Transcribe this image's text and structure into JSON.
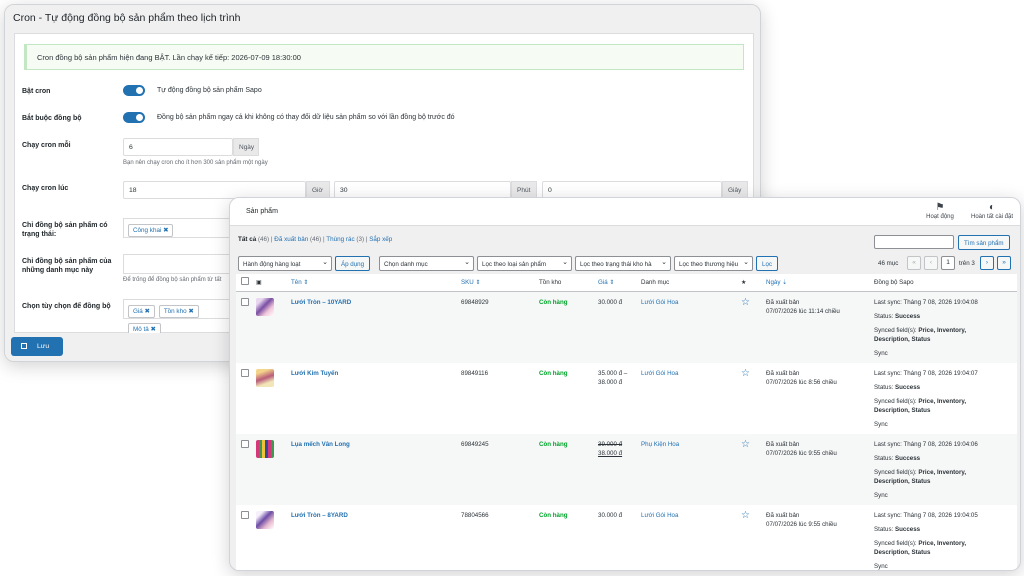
{
  "cron": {
    "title": "Cron - Tự động đồng bộ sản phẩm theo lịch trình",
    "notice": "Cron đồng bộ sản phẩm hiện đang BẬT. Lần chạy kế tiếp: 2026-07-09 18:30:00",
    "enable_label": "Bật cron",
    "enable_text": "Tự động đồng bộ sản phẩm Sapo",
    "force_label": "Bắt buộc đồng bộ",
    "force_text": "Đồng bộ sản phẩm ngay cả khi không có thay đổi dữ liệu sản phẩm so với lần đồng bộ trước đó",
    "every_label": "Chạy cron mỗi",
    "every_value": "6",
    "every_unit": "Ngày",
    "every_hint": "Bạn nên chạy cron cho ít hơn 300 sản phẩm một ngày",
    "at_label": "Chạy cron lúc",
    "hour_value": "18",
    "hour_unit": "Giờ",
    "minute_value": "30",
    "minute_unit": "Phút",
    "second_value": "0",
    "second_unit": "Giây",
    "status_label_1": "Chỉ đồng bộ sản phẩm có",
    "status_label_2": "trạng thái:",
    "status_tag": "Công khai ✖",
    "cat_label_1": "Chỉ đồng bộ sản phẩm của",
    "cat_label_2": "những danh mục này",
    "cat_hint": "Để trống để đồng bộ sản phẩm từ tất",
    "opt_label": "Chọn tùy chọn để đồng bộ",
    "opt_tags": [
      "Giá ✖",
      "Tồn kho ✖",
      "Mô tả ✖"
    ],
    "save": "Lưu"
  },
  "products": {
    "header_title": "Sản phẩm",
    "activity": "Hoạt động",
    "finish_setup": "Hoàn tất cài đặt",
    "sub_all": "Tất cả",
    "sub_all_count": "(46)",
    "sub_published": "Đã xuất bản",
    "sub_published_count": "(46)",
    "sub_trash": "Thùng rác",
    "sub_trash_count": "(3)",
    "sub_sort": "Sắp xếp",
    "search_button": "Tìm sản phẩm",
    "bulk": "Hành động hàng loạt",
    "apply": "Áp dụng",
    "filter_cat": "Chọn danh mục",
    "filter_type": "Lọc theo loại sản phẩm",
    "filter_stock": "Lọc theo trạng thái kho hà",
    "filter_brand": "Lọc theo thương hiệu",
    "filter_btn": "Lọc",
    "items_count": "46 mục",
    "page_current": "1",
    "page_of": "trên 3",
    "columns": {
      "name": "Tên ⇕",
      "sku": "SKU ⇕",
      "stock": "Tồn kho",
      "price": "Giá ⇕",
      "category": "Danh mục",
      "star": "★",
      "date": "Ngày ⇣",
      "sync": "Đồng bộ Sapo"
    },
    "rows": [
      {
        "name": "Lưới Tròn – 10YARD",
        "sku": "69848929",
        "stock": "Còn hàng",
        "price1": "30.000 đ",
        "price2": "",
        "category": "Lưới Gói Hoa",
        "date1": "Đã xuất bản",
        "date2": "07/07/2026 lúc 11:14 chiều",
        "sync_last": "Last sync: Tháng 7 08, 2026 19:04:08",
        "status": "Status:",
        "status_val": "Success",
        "fields": "Synced field(s):",
        "fields_val1": "Price, Inventory,",
        "fields_val2": "Description, Status",
        "sync_link": "Sync"
      },
      {
        "name": "Lưới Kim Tuyến",
        "sku": "89849116",
        "stock": "Còn hàng",
        "price1": "35.000 đ –",
        "price2": "38.000 đ",
        "category": "Lưới Gói Hoa",
        "date1": "Đã xuất bản",
        "date2": "07/07/2026 lúc 8:56 chiều",
        "sync_last": "Last sync: Tháng 7 08, 2026 19:04:07",
        "status": "Status:",
        "status_val": "Success",
        "fields": "Synced field(s):",
        "fields_val1": "Price, Inventory,",
        "fields_val2": "Description, Status",
        "sync_link": "Sync"
      },
      {
        "name": "Lụa mếch Vân Long",
        "sku": "69849245",
        "stock": "Còn hàng",
        "price1": "39.000 đ",
        "price2": "38.000 đ",
        "category": "Phụ Kiện Hoa",
        "date1": "Đã xuất bản",
        "date2": "07/07/2026 lúc 9:55 chiều",
        "sync_last": "Last sync: Tháng 7 08, 2026 19:04:06",
        "status": "Status:",
        "status_val": "Success",
        "fields": "Synced field(s):",
        "fields_val1": "Price, Inventory,",
        "fields_val2": "Description, Status",
        "sync_link": "Sync"
      },
      {
        "name": "Lưới Tròn – 8YARD",
        "sku": "78804566",
        "stock": "Còn hàng",
        "price1": "30.000 đ",
        "price2": "",
        "category": "Lưới Gói Hoa",
        "date1": "Đã xuất bản",
        "date2": "07/07/2026 lúc 9:55 chiều",
        "sync_last": "Last sync: Tháng 7 08, 2026 19:04:05",
        "status": "Status:",
        "status_val": "Success",
        "fields": "Synced field(s):",
        "fields_val1": "Price, Inventory,",
        "fields_val2": "Description, Status",
        "sync_link": "Sync"
      }
    ]
  },
  "colors": {
    "accent": "#2271b1",
    "success": "#00a32a"
  }
}
